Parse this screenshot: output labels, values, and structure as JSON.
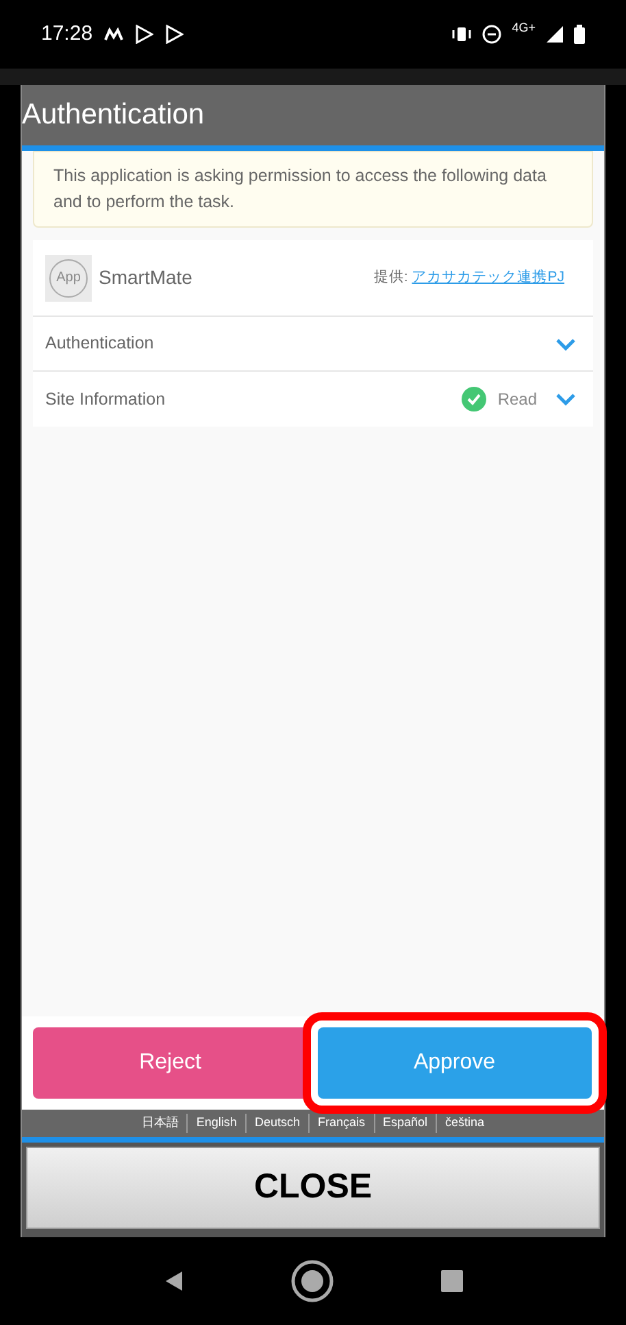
{
  "status_bar": {
    "time": "17:28",
    "network": "4G+"
  },
  "dialog": {
    "title": "Authentication",
    "notice": "This application is asking permission to access the following data and to perform the task.",
    "app": {
      "name": "SmartMate",
      "icon_label": "App",
      "provider_label": "提供:",
      "provider_link": "アカサカテック連携PJ"
    },
    "scopes": [
      {
        "name": "Authentication"
      },
      {
        "name": "Site Information",
        "permission": "Read"
      }
    ],
    "buttons": [
      {
        "label": "Reject",
        "kind": "reject",
        "highlighted": false
      },
      {
        "label": "Approve",
        "kind": "approve",
        "highlighted": true
      }
    ]
  },
  "languages": [
    "日本語",
    "English",
    "Deutsch",
    "Français",
    "Español",
    "čeština"
  ],
  "close_button": "CLOSE"
}
